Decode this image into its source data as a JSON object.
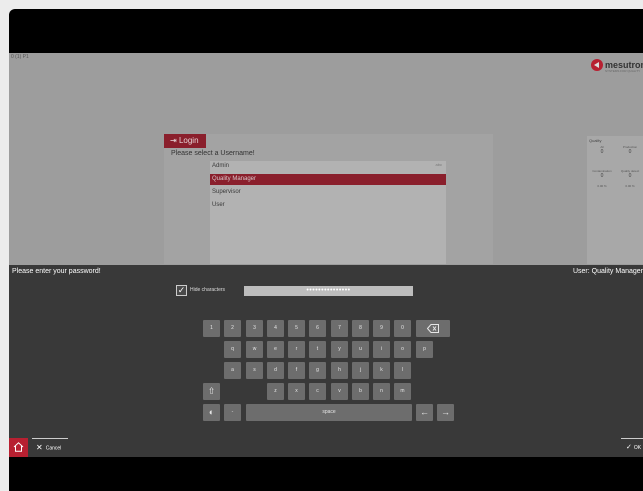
{
  "background_app": {
    "tag": "0 (1) P1",
    "logo_word": "mesutroni",
    "logo_sub": "SYSTEMS FOR QUALITY",
    "login": {
      "title": "Login",
      "prompt": "Please select a Username!",
      "list_hint": "abc",
      "users": [
        "Admin",
        "Quality Manager",
        "Supervisor",
        "User"
      ],
      "selected_index": 1
    },
    "quality": {
      "title": "Quality",
      "cells": [
        {
          "label": "All",
          "value": "0"
        },
        {
          "label": "Production",
          "value": "0"
        },
        {
          "label": "Contamination",
          "value": "0"
        },
        {
          "label": "Quality detect",
          "value": "0"
        },
        {
          "label": "0.00 %",
          "value": ""
        },
        {
          "label": "0.00 %",
          "value": ""
        }
      ]
    }
  },
  "keyboard": {
    "prompt": "Please enter your password!",
    "user_label": "User: Quality Manager",
    "hide_label": "Hide characters",
    "hide_checked": true,
    "password_mask": "•••••••••••••••",
    "rows": [
      [
        "1",
        "2",
        "3",
        "4",
        "5",
        "6",
        "7",
        "8",
        "9",
        "0"
      ],
      [
        "q",
        "w",
        "e",
        "r",
        "t",
        "y",
        "u",
        "i",
        "o",
        "p"
      ],
      [
        "a",
        "s",
        "d",
        "f",
        "g",
        "h",
        "j",
        "k",
        "l"
      ],
      [
        "z",
        "x",
        "c",
        "v",
        "b",
        "n",
        "m"
      ]
    ],
    "space_label": "space",
    "dash_label": "-",
    "icons": {
      "backspace": "backspace-icon",
      "shift": "shift-icon",
      "globe": "globe-icon",
      "left": "arrow-left-icon",
      "right": "arrow-right-icon",
      "home": "home-icon"
    }
  },
  "footer": {
    "cancel_label": "Cancel",
    "ok_label": "OK"
  },
  "colors": {
    "accent": "#b72031",
    "overlay": "#393939",
    "key": "#6d6d6d"
  }
}
